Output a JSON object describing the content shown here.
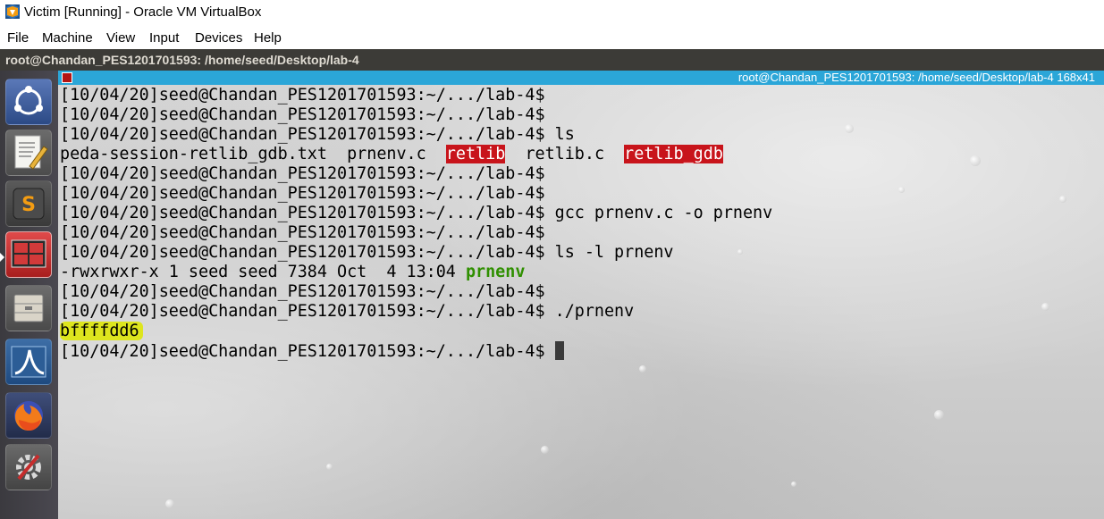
{
  "window": {
    "title": "Victim [Running] - Oracle VM VirtualBox"
  },
  "menubar": {
    "items": [
      "File",
      "Machine",
      "View",
      "Input",
      "Devices",
      "Help"
    ]
  },
  "guest": {
    "topbar_title": "root@Chandan_PES1201701593: /home/seed/Desktop/lab-4"
  },
  "launcher": {
    "items": [
      {
        "icon": "ubuntu-dash-icon"
      },
      {
        "icon": "text-editor-icon"
      },
      {
        "icon": "sublime-text-icon"
      },
      {
        "icon": "terminal-icon",
        "active": true
      },
      {
        "icon": "file-manager-icon"
      },
      {
        "icon": "wireshark-icon"
      },
      {
        "icon": "firefox-icon"
      },
      {
        "icon": "system-settings-icon"
      }
    ]
  },
  "terminal": {
    "header_title": "root@Chandan_PES1201701593: /home/seed/Desktop/lab-4 168x41",
    "prompt": "[10/04/20]seed@Chandan_PES1201701593:~/.../lab-4$",
    "lines": [
      {
        "type": "prompt",
        "cmd": ""
      },
      {
        "type": "prompt",
        "cmd": ""
      },
      {
        "type": "prompt",
        "cmd": " ls"
      },
      {
        "type": "ls",
        "items": [
          {
            "text": "peda-session-retlib_gdb.txt",
            "style": "plain"
          },
          {
            "text": "prnenv.c",
            "style": "plain"
          },
          {
            "text": "retlib",
            "style": "red"
          },
          {
            "text": "retlib.c",
            "style": "plain"
          },
          {
            "text": "retlib_gdb",
            "style": "red"
          }
        ]
      },
      {
        "type": "prompt",
        "cmd": ""
      },
      {
        "type": "prompt",
        "cmd": ""
      },
      {
        "type": "prompt",
        "cmd": " gcc prnenv.c -o prnenv"
      },
      {
        "type": "prompt",
        "cmd": ""
      },
      {
        "type": "prompt",
        "cmd": " ls -l prnenv"
      },
      {
        "type": "lsl",
        "meta": "-rwxrwxr-x 1 seed seed 7384 Oct  4 13:04 ",
        "name": "prnenv"
      },
      {
        "type": "prompt",
        "cmd": ""
      },
      {
        "type": "prompt",
        "cmd": " ./prnenv"
      },
      {
        "type": "output",
        "text": "bffffdd6",
        "highlight": "yellow"
      },
      {
        "type": "prompt",
        "cmd": " ",
        "cursor": true
      }
    ]
  },
  "colors": {
    "guest_topbar": "#3c3b37",
    "terminal_header": "#2ba6d8",
    "ls_red": "#c8141b",
    "exec_green": "#2f8f00",
    "marker_yellow": "#dde51e"
  }
}
